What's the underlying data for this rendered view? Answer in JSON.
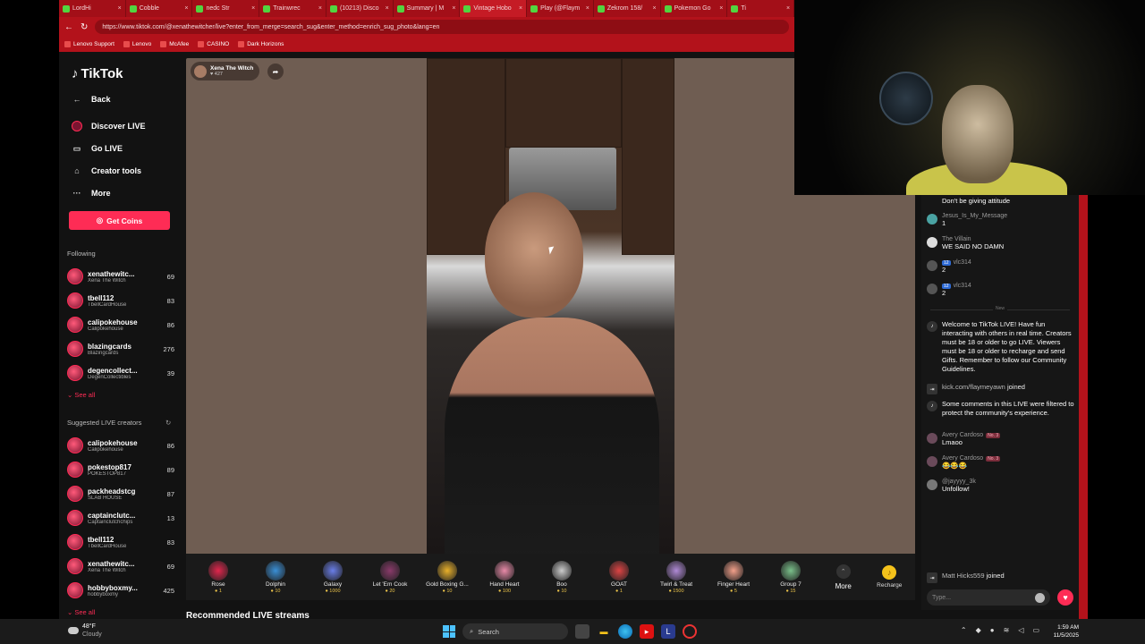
{
  "browser": {
    "tabs": [
      {
        "label": "LordHi"
      },
      {
        "label": "Cobble"
      },
      {
        "label": "nedc Str"
      },
      {
        "label": "Trainwrec"
      },
      {
        "label": "(10213) Disco"
      },
      {
        "label": "Summary | M"
      },
      {
        "label": "Vintage Hobo"
      },
      {
        "label": "Play (@Flaym"
      },
      {
        "label": "Zekrom 158/"
      },
      {
        "label": "Pokemon Go"
      },
      {
        "label": "Ti"
      }
    ],
    "url": "https://www.tiktok.com/@xenathewitcher/live?enter_from_merge=search_sug&enter_method=enrich_sug_photo&lang=en",
    "bookmarks": [
      "Lenovo Support",
      "Lenovo",
      "McAfee",
      "CASINO",
      "Dark Horizons"
    ]
  },
  "sidebar": {
    "logo": "TikTok",
    "back": "Back",
    "nav": [
      "Discover LIVE",
      "Go LIVE",
      "Creator tools",
      "More"
    ],
    "coins_button": "Get Coins",
    "following_title": "Following",
    "following": [
      {
        "name": "xenathewitc...",
        "sub": "Xena The Witch",
        "count": "69"
      },
      {
        "name": "tbell112",
        "sub": "TbellCardHouse",
        "count": "83"
      },
      {
        "name": "calipokehouse",
        "sub": "Calipokehouse",
        "count": "86"
      },
      {
        "name": "blazingcards",
        "sub": "Blazingcards",
        "count": "276"
      },
      {
        "name": "degencollect...",
        "sub": "DegenCollectibles",
        "count": "39"
      }
    ],
    "see_all_1": "See all",
    "suggested_title": "Suggested LIVE creators",
    "suggested": [
      {
        "name": "calipokehouse",
        "sub": "Calipokehouse",
        "count": "86"
      },
      {
        "name": "pokestop817",
        "sub": "POKESTOP817",
        "count": "89"
      },
      {
        "name": "packheadstcg",
        "sub": "SLAB HOUSE",
        "count": "87"
      },
      {
        "name": "captainclutc...",
        "sub": "Captainclutchchips",
        "count": "13"
      },
      {
        "name": "tbell112",
        "sub": "TbellCardHouse",
        "count": "83"
      },
      {
        "name": "xenathewitc...",
        "sub": "Xena The Witch",
        "count": "69"
      },
      {
        "name": "hobbyboxmy...",
        "sub": "hobbyboxmy",
        "count": "425"
      }
    ],
    "see_all_2": "See all"
  },
  "stream": {
    "host_name": "Xena The Witch",
    "host_likes": "427",
    "gifts": [
      {
        "name": "Rose",
        "price": "1",
        "icon": "rose-icon"
      },
      {
        "name": "Dolphin",
        "price": "10",
        "icon": "dolphin-icon"
      },
      {
        "name": "Galaxy",
        "price": "1000",
        "icon": "galaxy-icon"
      },
      {
        "name": "Let 'Em Cook",
        "price": "20",
        "icon": "cook-icon"
      },
      {
        "name": "Gold Boxing G...",
        "price": "10",
        "icon": "boxing-glove-icon"
      },
      {
        "name": "Hand Heart",
        "price": "100",
        "icon": "hand-heart-icon"
      },
      {
        "name": "Boo",
        "price": "10",
        "icon": "ghost-icon"
      },
      {
        "name": "GOAT",
        "price": "1",
        "icon": "goat-icon"
      },
      {
        "name": "Twirl & Treat",
        "price": "1500",
        "icon": "twirl-icon"
      },
      {
        "name": "Finger Heart",
        "price": "5",
        "icon": "finger-heart-icon"
      },
      {
        "name": "Group 7",
        "price": "15",
        "icon": "group-icon"
      }
    ],
    "more": "More",
    "recharge": "Recharge",
    "recommended": "Recommended LIVE streams"
  },
  "chat": {
    "messages": [
      {
        "user": "",
        "text": "Don't be giving attitude"
      },
      {
        "user": "Jesus_Is_My_Message",
        "text": "1"
      },
      {
        "user": "The Villain",
        "text": "WE SAID NO DAMN"
      },
      {
        "user": "vlc314",
        "badge": "12",
        "text": "2"
      },
      {
        "user": "vlc314",
        "badge": "12",
        "text": "2"
      }
    ],
    "new_label": "New",
    "welcome": "Welcome to TikTok LIVE! Have fun interacting with others in real time. Creators must be 18 or older to go LIVE. Viewers must be 18 or older to recharge and send Gifts. Remember to follow our Community Guidelines.",
    "join1_user": "kick.com/flaymeyawn",
    "join_word": "joined",
    "filtered": "Some comments in this LIVE were filtered to protect the community's experience.",
    "later": [
      {
        "user": "Avery Cardoso",
        "badge": "No. 3",
        "text": "Lmaoo"
      },
      {
        "user": "Avery Cardoso",
        "badge": "No. 3",
        "text": "😂😂😂"
      },
      {
        "user": "@jayyyy_3k",
        "text": "Unfollow!"
      }
    ],
    "join2_user": "Matt Hicks559",
    "input_placeholder": "Type..."
  },
  "taskbar": {
    "temp": "48°F",
    "weather": "Cloudy",
    "search": "Search",
    "time": "1:59 AM",
    "date": "11/5/2025"
  }
}
